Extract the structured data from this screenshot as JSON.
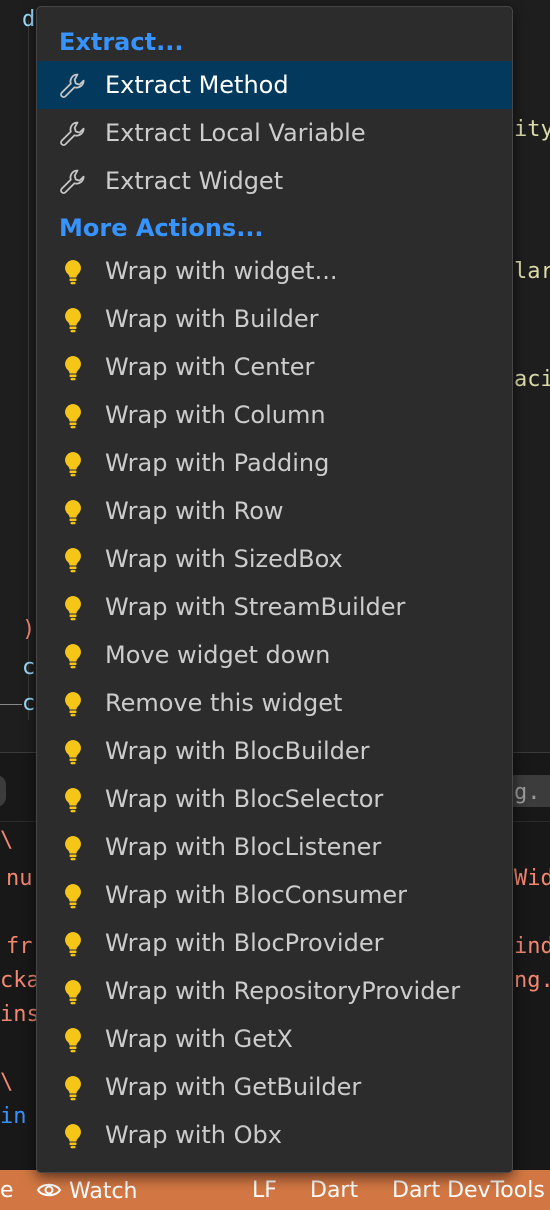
{
  "menu": {
    "sections": [
      {
        "header": "Extract...",
        "items": [
          {
            "label": "Extract Method",
            "icon": "wrench-icon",
            "selected": true
          },
          {
            "label": "Extract Local Variable",
            "icon": "wrench-icon"
          },
          {
            "label": "Extract Widget",
            "icon": "wrench-icon"
          }
        ]
      },
      {
        "header": "More Actions...",
        "items": [
          {
            "label": "Wrap with widget...",
            "icon": "lightbulb-icon"
          },
          {
            "label": "Wrap with Builder",
            "icon": "lightbulb-icon"
          },
          {
            "label": "Wrap with Center",
            "icon": "lightbulb-icon"
          },
          {
            "label": "Wrap with Column",
            "icon": "lightbulb-icon"
          },
          {
            "label": "Wrap with Padding",
            "icon": "lightbulb-icon"
          },
          {
            "label": "Wrap with Row",
            "icon": "lightbulb-icon"
          },
          {
            "label": "Wrap with SizedBox",
            "icon": "lightbulb-icon"
          },
          {
            "label": "Wrap with StreamBuilder",
            "icon": "lightbulb-icon"
          },
          {
            "label": "Move widget down",
            "icon": "lightbulb-icon"
          },
          {
            "label": "Remove this widget",
            "icon": "lightbulb-icon"
          },
          {
            "label": "Wrap with BlocBuilder",
            "icon": "lightbulb-icon"
          },
          {
            "label": "Wrap with BlocSelector",
            "icon": "lightbulb-icon"
          },
          {
            "label": "Wrap with BlocListener",
            "icon": "lightbulb-icon"
          },
          {
            "label": "Wrap with BlocConsumer",
            "icon": "lightbulb-icon"
          },
          {
            "label": "Wrap with BlocProvider",
            "icon": "lightbulb-icon"
          },
          {
            "label": "Wrap with RepositoryProvider",
            "icon": "lightbulb-icon"
          },
          {
            "label": "Wrap with GetX",
            "icon": "lightbulb-icon"
          },
          {
            "label": "Wrap with GetBuilder",
            "icon": "lightbulb-icon"
          },
          {
            "label": "Wrap with Obx",
            "icon": "lightbulb-icon"
          }
        ]
      }
    ]
  },
  "editor": {
    "fragments_left": [
      "d",
      ")",
      "c",
      "c"
    ],
    "fragments_right": [
      "ity",
      "lar",
      "aci"
    ]
  },
  "panel": {
    "filter_right_text": "g. t",
    "lines_left": [
      "\\",
      "nu",
      "fr",
      "cka",
      "ins",
      "\\",
      "in"
    ],
    "lines_right": [
      "Wid",
      "ind",
      "ng."
    ]
  },
  "statusbar": {
    "left_fragment": "e",
    "watch_label": "Watch",
    "eol": "LF",
    "language": "Dart",
    "devtools": "Dart DevTools"
  },
  "colors": {
    "accent": "#3794ff",
    "selection": "#04395e",
    "lightbulb": "#f5c518",
    "statusbar": "#d27743",
    "error_text": "#f48771"
  }
}
